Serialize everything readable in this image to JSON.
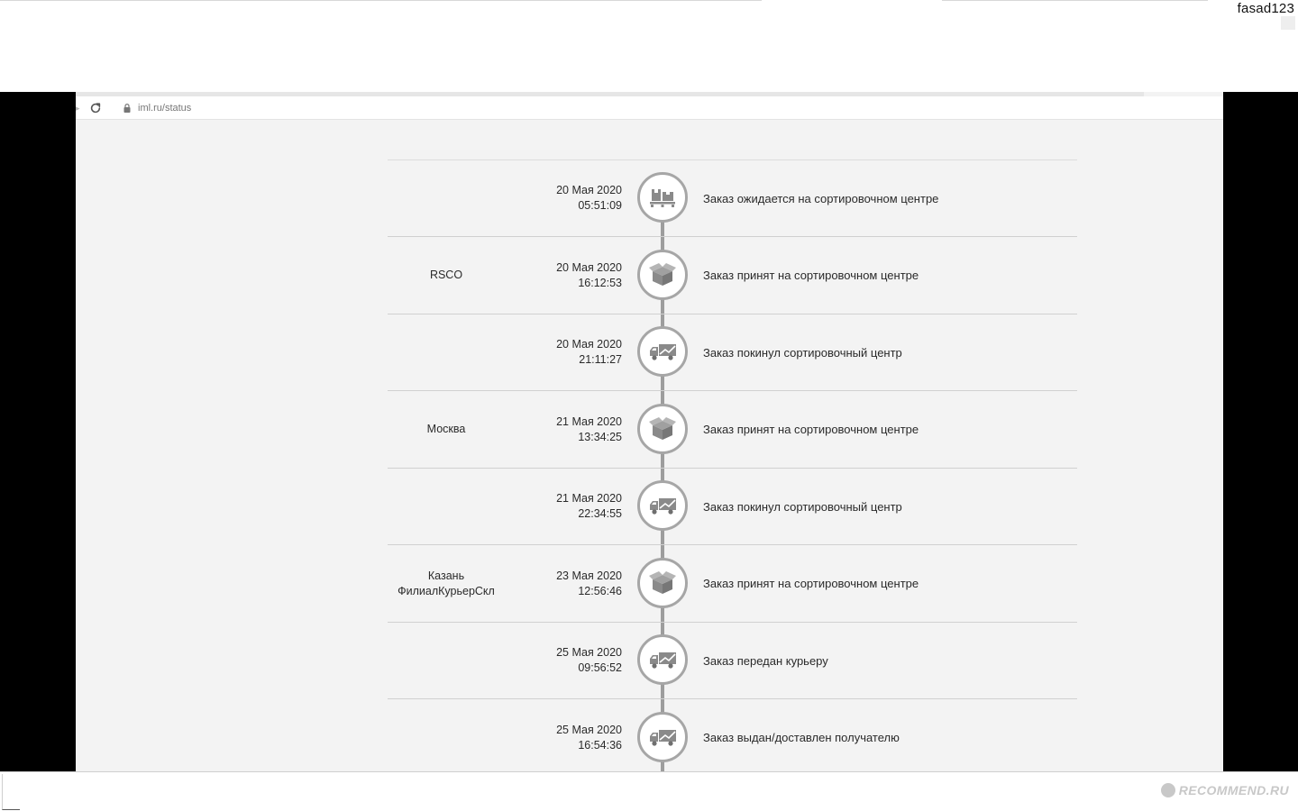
{
  "user": {
    "name": "fasad123"
  },
  "browser": {
    "url_domain": "iml.ru",
    "url_path": "/status"
  },
  "events": [
    {
      "location": "",
      "location2": "",
      "date": "20 Мая 2020",
      "time": "05:51:09",
      "status": "Заказ ожидается на сортировочном центре",
      "icon": "pallet-icon"
    },
    {
      "location": "RSCO",
      "location2": "",
      "date": "20 Мая 2020",
      "time": "16:12:53",
      "status": "Заказ принят на сортировочном центре",
      "icon": "box-icon"
    },
    {
      "location": "",
      "location2": "",
      "date": "20 Мая 2020",
      "time": "21:11:27",
      "status": "Заказ покинул сортировочный центр",
      "icon": "truck-icon"
    },
    {
      "location": "Москва",
      "location2": "",
      "date": "21 Мая 2020",
      "time": "13:34:25",
      "status": "Заказ принят на сортировочном центре",
      "icon": "box-icon"
    },
    {
      "location": "",
      "location2": "",
      "date": "21 Мая 2020",
      "time": "22:34:55",
      "status": "Заказ покинул сортировочный центр",
      "icon": "truck-icon"
    },
    {
      "location": "Казань",
      "location2": "ФилиалКурьерСкл",
      "date": "23 Мая 2020",
      "time": "12:56:46",
      "status": "Заказ принят на сортировочном центре",
      "icon": "box-icon"
    },
    {
      "location": "",
      "location2": "",
      "date": "25 Мая 2020",
      "time": "09:56:52",
      "status": "Заказ передан курьеру",
      "icon": "truck-icon"
    },
    {
      "location": "",
      "location2": "",
      "date": "25 Мая 2020",
      "time": "16:54:36",
      "status": "Заказ выдан/доставлен получателю",
      "icon": "truck-icon"
    }
  ],
  "watermark": {
    "text": "RECOMMEND.RU"
  },
  "colors": {
    "timeline": "#9d9d9d",
    "icon": "#8a8a8a",
    "text": "#2a2a2a",
    "page_bg": "#f3f3f3"
  }
}
